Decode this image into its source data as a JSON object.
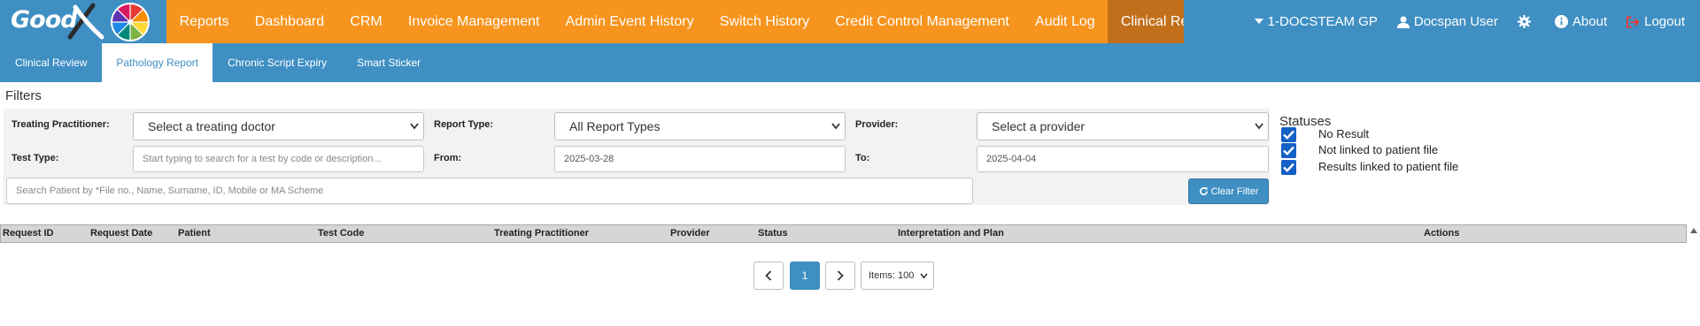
{
  "brand": {
    "logo_text": "Good",
    "logo_x": "X"
  },
  "nav": {
    "items": [
      {
        "label": "Reports",
        "active": false
      },
      {
        "label": "Dashboard",
        "active": false
      },
      {
        "label": "CRM",
        "active": false
      },
      {
        "label": "Invoice Management",
        "active": false
      },
      {
        "label": "Admin Event History",
        "active": false
      },
      {
        "label": "Switch History",
        "active": false
      },
      {
        "label": "Credit Control Management",
        "active": false
      },
      {
        "label": "Audit Log",
        "active": false
      },
      {
        "label": "Clinical Reports",
        "active": true
      }
    ],
    "practice_selector": "1-DOCSTEAM GP",
    "user": "Docspan User",
    "settings_icon": "gear-icon",
    "about": "About",
    "logout": "Logout"
  },
  "subtabs": [
    {
      "label": "Clinical Review",
      "active": false
    },
    {
      "label": "Pathology Report",
      "active": true
    },
    {
      "label": "Chronic Script Expiry",
      "active": false
    },
    {
      "label": "Smart Sticker",
      "active": false
    }
  ],
  "filters": {
    "title": "Filters",
    "treating_practitioner_label": "Treating Practitioner:",
    "treating_practitioner_value": "Select a treating doctor",
    "report_type_label": "Report Type:",
    "report_type_value": "All Report Types",
    "provider_label": "Provider:",
    "provider_value": "Select a provider",
    "test_type_label": "Test Type:",
    "test_type_placeholder": "Start typing to search for a test by code or description...",
    "from_label": "From:",
    "from_value": "2025-03-28",
    "to_label": "To:",
    "to_value": "2025-04-04",
    "search_placeholder": "Search Patient by *File no., Name, Surname, ID, Mobile or MA Scheme",
    "clear_button": "Clear Filter"
  },
  "statuses": {
    "title": "Statuses",
    "items": [
      {
        "label": "No Result",
        "checked": true
      },
      {
        "label": "Not linked to patient file",
        "checked": true
      },
      {
        "label": "Results linked to patient file",
        "checked": true
      }
    ]
  },
  "table": {
    "columns": [
      "Request ID",
      "Request Date",
      "Patient",
      "Test Code",
      "Treating Practitioner",
      "Provider",
      "Status",
      "Interpretation and Plan",
      "Actions"
    ],
    "rows": []
  },
  "pagination": {
    "current_page": "1",
    "items_per_page": "Items: 100"
  },
  "colors": {
    "brand_orange": "#f7941d",
    "brand_blue": "#3f8fc3",
    "active_nav": "#c26f1c",
    "checkbox_blue": "#1560c6"
  }
}
